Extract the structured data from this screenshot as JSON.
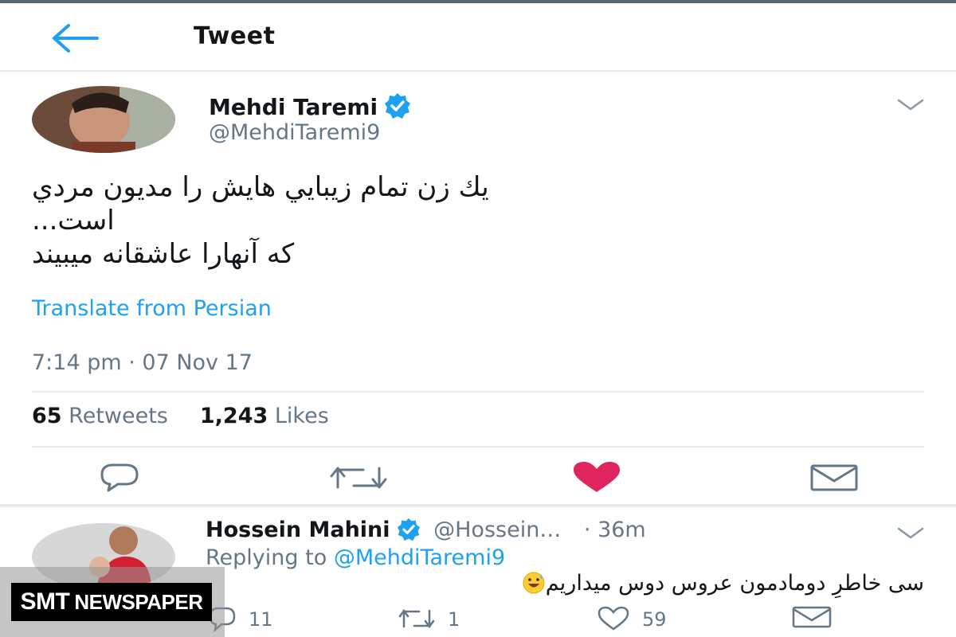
{
  "colors": {
    "accent": "#1da1f2",
    "like_active": "#e0245e",
    "muted": "#657786",
    "divider": "#e6ecf0"
  },
  "header": {
    "title": "Tweet",
    "back_icon": "arrow-left-icon"
  },
  "tweet": {
    "author": {
      "name": "Mehdi Taremi",
      "handle": "@MehdiTaremi9",
      "verified": true
    },
    "text_lines": [
      "يك زن تمام زيبايي هايش را مديون مردي",
      "است...",
      "که آنهارا عاشقانه میبیند"
    ],
    "translate_label": "Translate from Persian",
    "timestamp": "7:14 pm · 07 Nov 17",
    "stats": {
      "retweets_count": "65",
      "retweets_label": "Retweets",
      "likes_count": "1,243",
      "likes_label": "Likes"
    },
    "actions": [
      "reply-icon",
      "retweet-icon",
      "heart-icon",
      "mail-icon"
    ],
    "liked": true
  },
  "reply": {
    "author": {
      "name": "Hossein Mahini",
      "handle": "@Hossein…",
      "time": "· 36m",
      "verified": true
    },
    "replying_label": "Replying to",
    "replying_to": "@MehdiTaremi9",
    "text": "سی خاطرِ دومادمون عروس دوس میداریم",
    "emoji": "grinning-sweat-emoji",
    "counts": {
      "replies": "11",
      "retweets": "1",
      "likes": "59"
    }
  },
  "watermark": {
    "text_big": "SMT",
    "text_small": "NEWSPAPER"
  }
}
